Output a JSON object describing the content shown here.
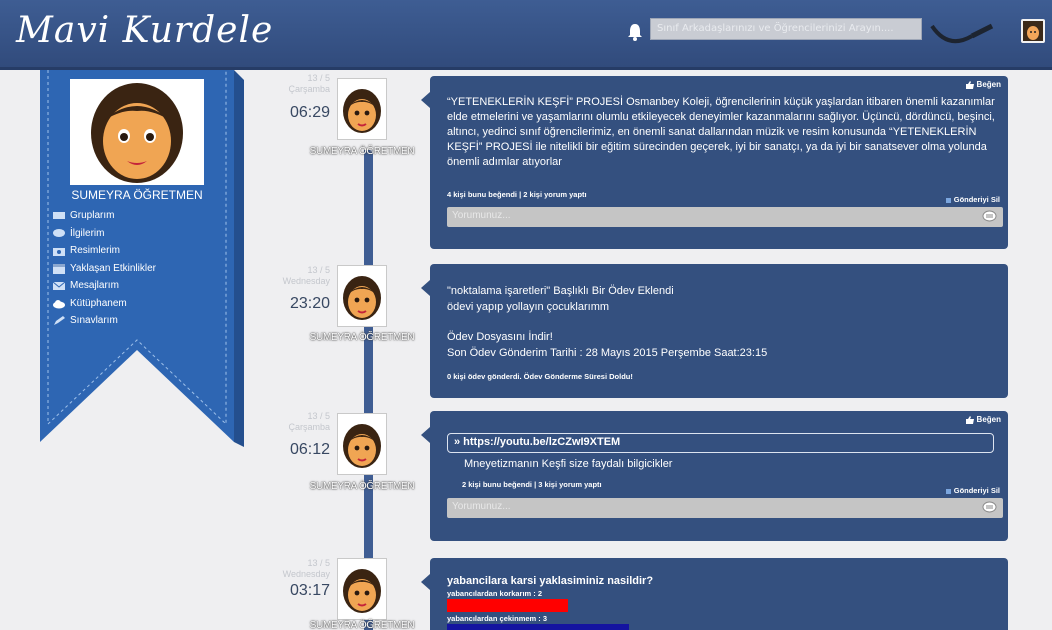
{
  "header": {
    "logo": "Mavi Kurdele",
    "search_placeholder": "Sınıf Arkadaşlarınızı ve Öğrencilerinizi Arayın...."
  },
  "sidebar": {
    "profile_name": "SUMEYRA ÖĞRETMEN",
    "menu": [
      {
        "label": "Gruplarım",
        "icon": "groups-icon"
      },
      {
        "label": "İlgilerim",
        "icon": "interests-icon"
      },
      {
        "label": "Resimlerim",
        "icon": "camera-icon"
      },
      {
        "label": "Yaklaşan Etkinlikler",
        "icon": "calendar-icon"
      },
      {
        "label": "Mesajlarım",
        "icon": "mail-icon"
      },
      {
        "label": "Kütüphanem",
        "icon": "cloud-icon"
      },
      {
        "label": "Sınavlarım",
        "icon": "pen-icon"
      }
    ]
  },
  "posts": [
    {
      "date": "13 / 5",
      "day": "Çarşamba",
      "time": "06:29",
      "author": "SUMEYRA ÖĞRETMEN",
      "like_label": "Beğen",
      "text": "“YETENEKLERİN KEŞFİ” PROJESİ Osmanbey Koleji, öğrencilerinin küçük yaşlardan itibaren önemli kazanımlar elde etmelerini ve yaşamlarını olumlu etkileyecek deneyimler kazanmalarını sağlıyor. Üçüncü, dördüncü, beşinci, altıncı, yedinci sınıf öğrencilerimiz, en önemli sanat dallarından müzik ve resim konusunda “YETENEKLERİN KEŞFİ” PROJESİ ile nitelikli bir eğitim sürecinden geçerek, iyi bir sanatçı, ya da iyi bir sanatsever olma yolunda önemli adımlar atıyorlar",
      "stats": "4 kişi bunu beğendi | 2 kişi yorum yaptı",
      "delete_label": "Gönderiyi Sil",
      "comment_placeholder": "Yorumunuz..."
    },
    {
      "date": "13 / 5",
      "day": "Wednesday",
      "time": "23:20",
      "author": "SUMEYRA ÖĞRETMEN",
      "title": "\"noktalama işaretleri\" Başlıklı Bir Ödev Eklendi",
      "line2": "ödevi yapıp yollayın çocuklarımm",
      "download": "Ödev Dosyasını İndir!",
      "deadline": "Son Ödev Gönderim Tarihi : 28 Mayıs 2015 Perşembe Saat:23:15",
      "stats": "0 kişi ödev gönderdi. Ödev Gönderme Süresi Doldu!"
    },
    {
      "date": "13 / 5",
      "day": "Çarşamba",
      "time": "06:12",
      "author": "SUMEYRA ÖĞRETMEN",
      "like_label": "Beğen",
      "link": "» https://youtu.be/lzCZwI9XTEM",
      "link_desc": "Mneyetizmanın Keşfi size faydalı bilgicikler",
      "stats": "2 kişi bunu beğendi | 3 kişi yorum yaptı",
      "delete_label": "Gönderiyi Sil",
      "comment_placeholder": "Yorumunuz..."
    },
    {
      "date": "13 / 5",
      "day": "Wednesday",
      "time": "03:17",
      "author": "SUMEYRA ÖĞRETMEN",
      "question": "yabancilara karsi yaklasiminiz nasildir?",
      "options": [
        {
          "label": "yabancılardan korkarım : 2",
          "votes": 2,
          "color": "#ff0000"
        },
        {
          "label": "yabancılardan çekinmem : 3",
          "votes": 3,
          "color": "#1414a0"
        }
      ]
    }
  ]
}
